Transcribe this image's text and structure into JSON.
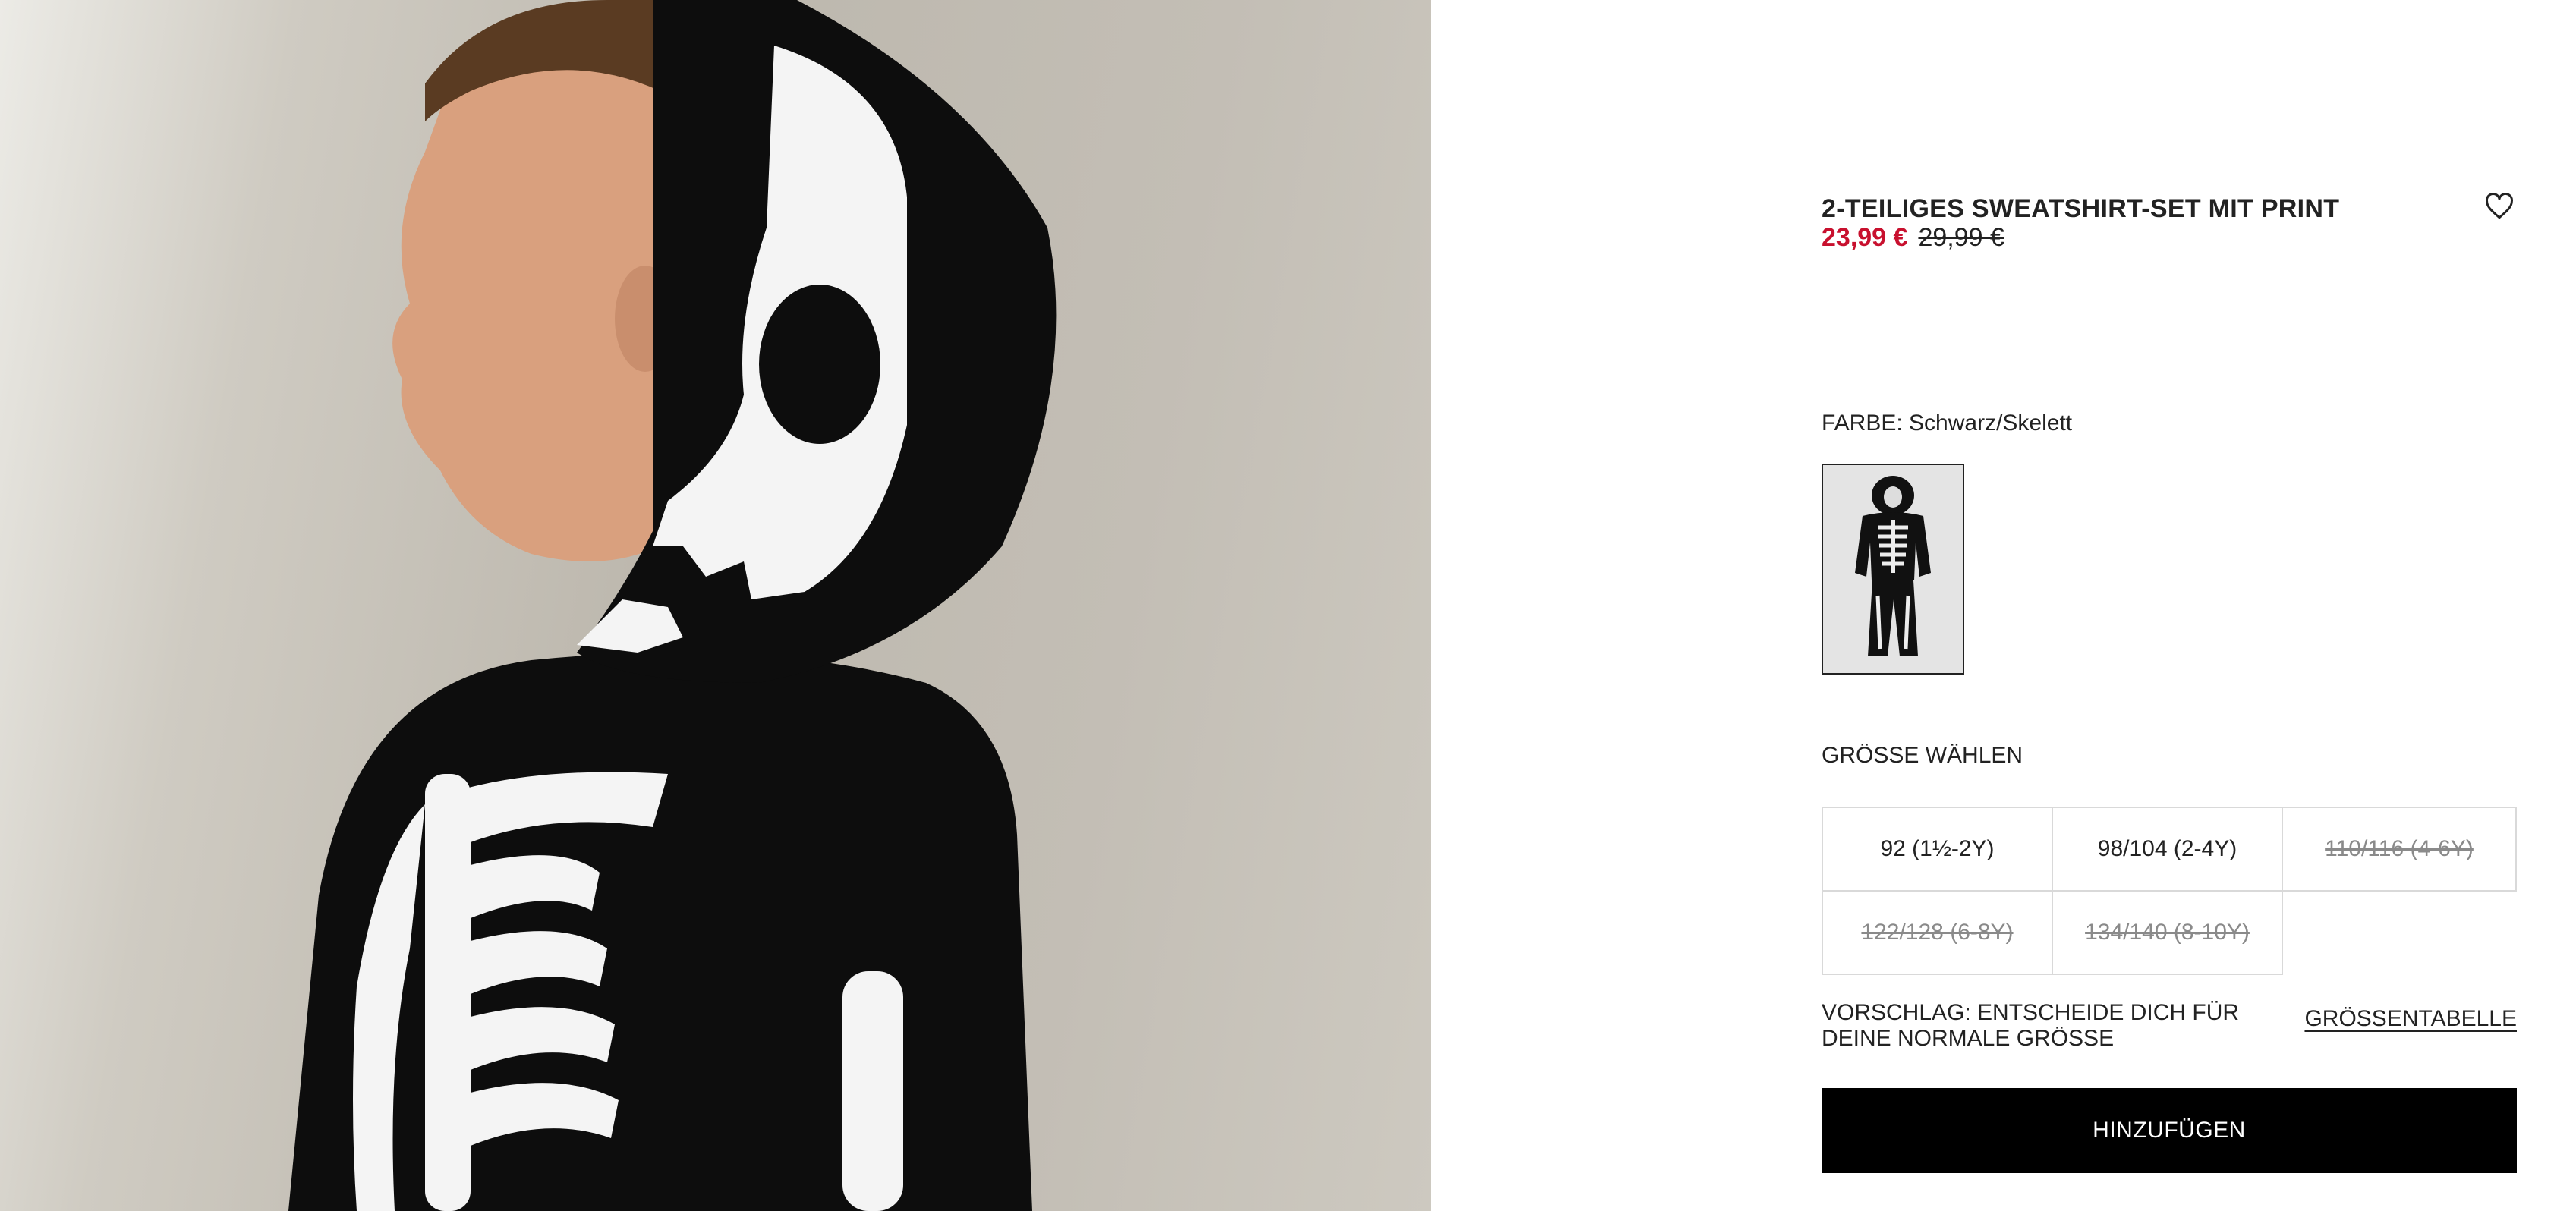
{
  "product": {
    "title": "2-TEILIGES SWEATSHIRT-SET MIT PRINT",
    "price_sale": "23,99 €",
    "price_original": "29,99 €",
    "favorite_icon": "heart-outline-icon"
  },
  "color": {
    "label": "FARBE: Schwarz/Skelett",
    "swatches": [
      {
        "name": "Schwarz/Skelett",
        "selected": true
      }
    ]
  },
  "size": {
    "label": "GRÖSSE WÄHLEN",
    "options": [
      {
        "label": "92 (1½-2Y)",
        "available": true
      },
      {
        "label": "98/104 (2-4Y)",
        "available": true
      },
      {
        "label": "110/116 (4-6Y)",
        "available": false
      },
      {
        "label": "122/128 (6-8Y)",
        "available": false
      },
      {
        "label": "134/140 (8-10Y)",
        "available": false
      }
    ],
    "hint": "VORSCHLAG: ENTSCHEIDE DICH FÜR DEINE NORMALE GRÖSSE",
    "size_chart_link": "GRÖSSENTABELLE"
  },
  "actions": {
    "add_to_cart": "HINZUFÜGEN"
  },
  "colors": {
    "sale": "#c8102e",
    "button_bg": "#000000",
    "button_text": "#ffffff",
    "border": "#d9d9d9"
  }
}
